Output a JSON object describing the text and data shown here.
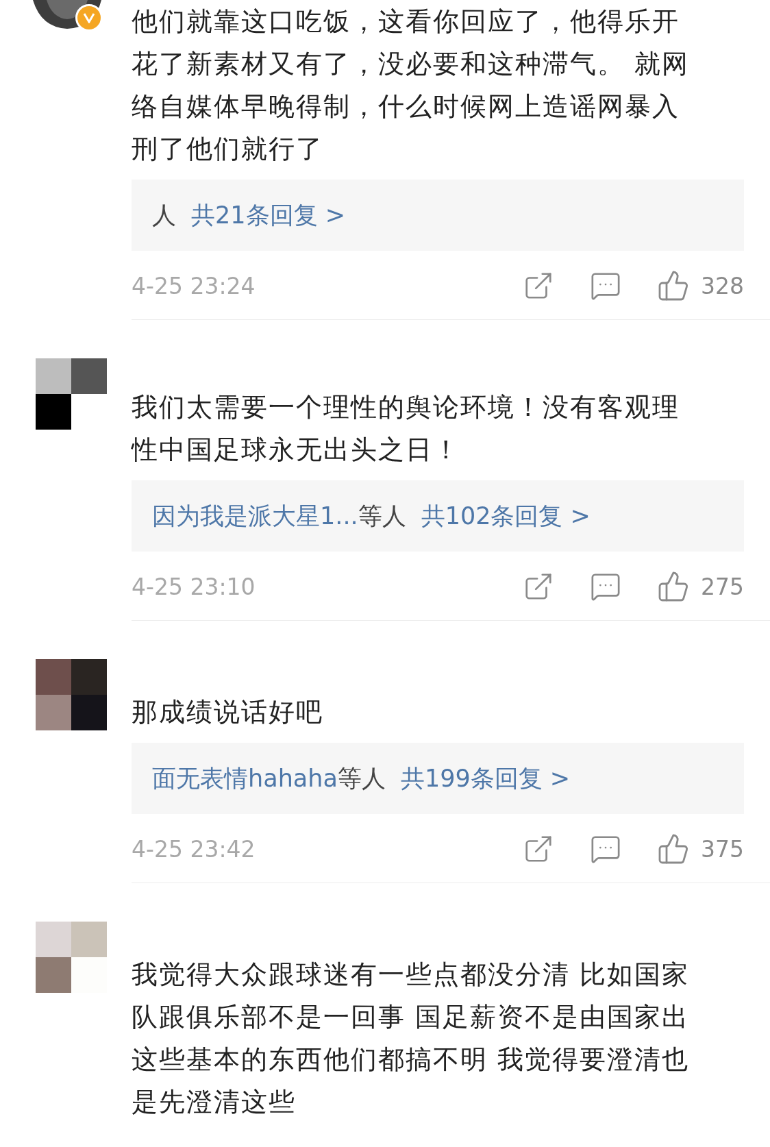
{
  "comments": [
    {
      "verified": true,
      "avatar_cut": true,
      "lines": [
        "他们就靠这口吃饭，这看你回应了，他得乐开",
        "花了新素材又有了，没必要和这种滞气。 就网",
        "络自媒体早晚得制，什么时候网上造谣网暴入",
        "刑了他们就行了"
      ],
      "replies": {
        "suffix": "人",
        "count": "共21条回复 >"
      },
      "time": "4-25 23:24",
      "likes": "328"
    },
    {
      "verified": false,
      "avatar_cut": false,
      "lines": [
        "我们太需要一个理性的舆论环境！没有客观理",
        "性中国足球永无出头之日！"
      ],
      "replies": {
        "names": "因为我是派大星1...",
        "suffix": "等人",
        "count": "共102条回复 >"
      },
      "time": "4-25 23:10",
      "likes": "275"
    },
    {
      "verified": false,
      "avatar_cut": false,
      "lines": [
        "那成绩说话好吧"
      ],
      "replies": {
        "names": "面无表情hahaha",
        "suffix": "等人",
        "count": "共199条回复 >"
      },
      "time": "4-25 23:42",
      "likes": "375"
    },
    {
      "verified": false,
      "avatar_cut": false,
      "lines": [
        "我觉得大众跟球迷有一些点都没分清 比如国家",
        "队跟俱乐部不是一回事 国足薪资不是由国家出",
        "这些基本的东西他们都搞不明 我觉得要澄清也",
        "是先澄清这些"
      ]
    }
  ]
}
